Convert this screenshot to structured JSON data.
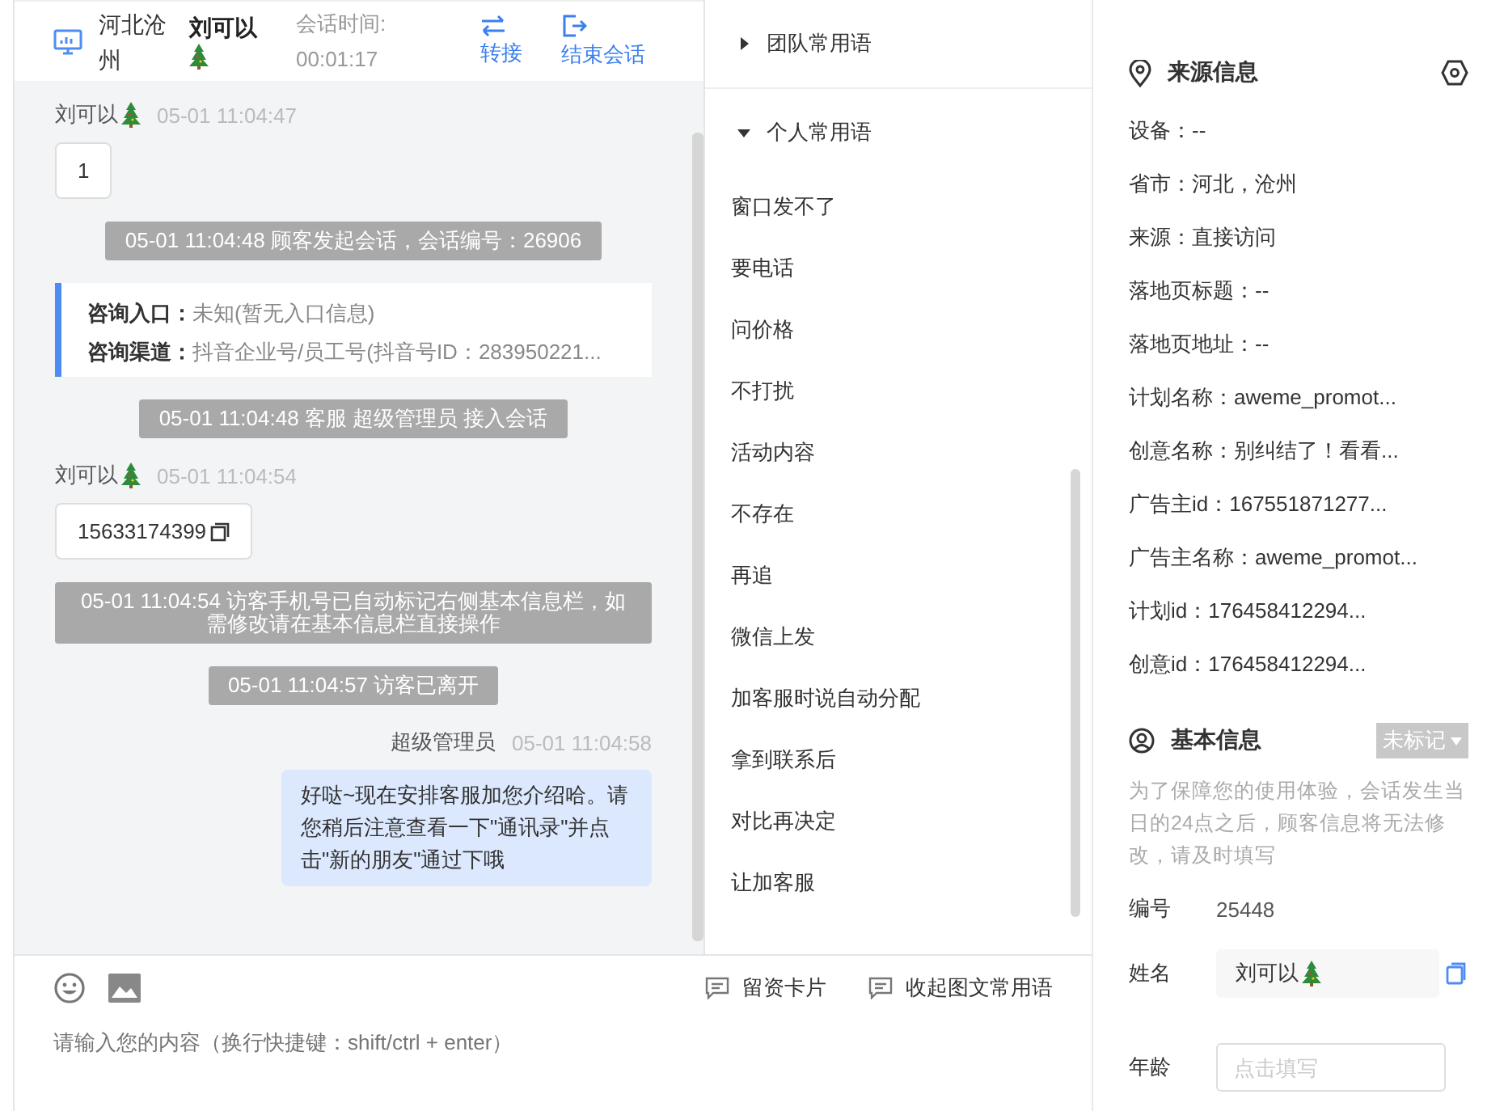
{
  "header": {
    "location": "河北沧州",
    "visitor_name": "刘可以",
    "timer_label": "会话时间:",
    "timer_value": "00:01:17",
    "actions": [
      {
        "label": "转接",
        "kind": "transfer"
      },
      {
        "label": "结束会话",
        "kind": "end"
      }
    ]
  },
  "messages": [
    {
      "kind": "visitor",
      "sender": "刘可以",
      "time": "05-01 11:04:47",
      "text": "1",
      "copyable": false
    },
    {
      "kind": "system",
      "text": "05-01 11:04:48 顾客发起会话，会话编号：26906"
    },
    {
      "kind": "info",
      "rows": [
        {
          "label": "咨询入口：",
          "value": "未知(暂无入口信息)"
        },
        {
          "label": "咨询渠道：",
          "value": "抖音企业号/员工号(抖音号ID：283950221..."
        }
      ]
    },
    {
      "kind": "system",
      "text": "05-01 11:04:48 客服 超级管理员 接入会话"
    },
    {
      "kind": "visitor",
      "sender": "刘可以",
      "time": "05-01 11:04:54",
      "text": "15633174399",
      "copyable": true
    },
    {
      "kind": "system",
      "text": "05-01 11:04:54 访客手机号已自动标记右侧基本信息栏，如需修改请在基本信息栏直接操作"
    },
    {
      "kind": "system",
      "text": "05-01 11:04:57 访客已离开"
    },
    {
      "kind": "agent",
      "sender": "超级管理员",
      "time": "05-01 11:04:58",
      "text": "好哒~现在安排客服加您介绍哈。请您稍后注意查看一下\"通讯录\"并点击\"新的朋友\"通过下哦"
    }
  ],
  "phrase_groups": [
    {
      "title": "团队常用语",
      "expanded": false
    },
    {
      "title": "个人常用语",
      "expanded": true,
      "items": [
        "窗口发不了",
        "要电话",
        "问价格",
        "不打扰",
        "活动内容",
        "不存在",
        "再追",
        "微信上发",
        "加客服时说自动分配",
        "拿到联系后",
        "对比再决定",
        "让加客服"
      ]
    }
  ],
  "composer": {
    "placeholder": "请输入您的内容（换行快捷键：shift/ctrl + enter）",
    "tools": [
      {
        "label": "留资卡片"
      },
      {
        "label": "收起图文常用语"
      }
    ]
  },
  "source": {
    "title": "来源信息",
    "lines": [
      "设备：--",
      "省市：河北，沧州",
      "来源：直接访问",
      "落地页标题：--",
      "落地页地址：--",
      "计划名称：aweme_promot...",
      "创意名称：别纠结了！看看...",
      "广告主id：167551871277...",
      "广告主名称：aweme_promot...",
      "计划id：176458412294...",
      "创意id：176458412294..."
    ]
  },
  "basic": {
    "title": "基本信息",
    "tag": "未标记",
    "notice": "为了保障您的使用体验，会话发生当日的24点之后，顾客信息将无法修改，请及时填写",
    "fields": [
      {
        "kind": "text",
        "label": "编号",
        "value": "25448"
      },
      {
        "kind": "filled",
        "label": "姓名",
        "value": "刘可以"
      },
      {
        "kind": "input",
        "label": "年龄",
        "placeholder": "点击填写"
      }
    ]
  }
}
